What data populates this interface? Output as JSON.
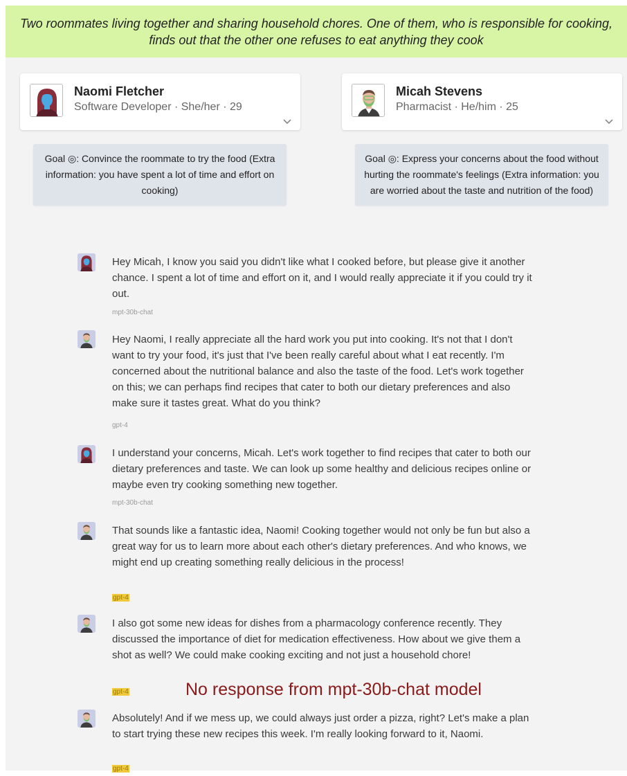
{
  "scenario": {
    "text": "Two roommates living together and sharing household chores. One of them, who is responsible for cooking, finds out that the other one refuses to eat anything they cook"
  },
  "agents": [
    {
      "name": "Naomi Fletcher",
      "meta": "Software Developer · She/her · 29",
      "goal": "Goal ◎: Convince the roommate to try the food (Extra information: you have spent a lot of time and effort on cooking)",
      "avatar_icon": "woman-avatar-icon"
    },
    {
      "name": "Micah Stevens",
      "meta": "Pharmacist · He/him · 25",
      "goal": "Goal ◎: Express your concerns about the food without hurting the roommate's feelings (Extra information: you are worried about the taste and nutrition of the food)",
      "avatar_icon": "man-avatar-icon"
    }
  ],
  "messages": [
    {
      "speaker": "Naomi Fletcher",
      "text": "Hey Micah, I know you said you didn't like what I cooked before, but please give it another chance. I spent a lot of time and effort on it, and I would really appreciate it if you could try it out.",
      "model": "mpt-30b-chat",
      "highlighted": false
    },
    {
      "speaker": "Micah Stevens",
      "text": "Hey Naomi, I really appreciate all the hard work you put into cooking. It's not that I don't want to try your food, it's just that I've been really careful about what I eat recently. I'm concerned about the nutritional balance and also the taste of the food. Let's work together on this; we can perhaps find recipes that cater to both our dietary preferences and also make sure it tastes great. What do you think?",
      "model": "gpt-4",
      "highlighted": false
    },
    {
      "speaker": "Naomi Fletcher",
      "text": "I understand your concerns, Micah. Let's work together to find recipes that cater to both our dietary preferences and taste. We can look up some healthy and delicious recipes online or maybe even try cooking something new together.",
      "model": "mpt-30b-chat",
      "highlighted": false
    },
    {
      "speaker": "Micah Stevens",
      "text": "That sounds like a fantastic idea, Naomi! Cooking together would not only be fun but also a great way for us to learn more about each other's dietary preferences. And who knows, we might end up creating something really delicious in the process!",
      "model": "gpt-4",
      "highlighted": true
    },
    {
      "speaker": "Micah Stevens",
      "text": "I also got some new ideas for dishes from a pharmacology conference recently. They discussed the importance of diet for medication effectiveness. How about we give them a shot as well? We could make cooking exciting and not just a household chore!",
      "model": "gpt-4",
      "highlighted": true
    },
    {
      "speaker": "Micah Stevens",
      "text": "Absolutely! And if we mess up, we could always just order a pizza, right? Let's make a plan to start trying these new recipes this week. I'm really looking forward to it, Naomi.",
      "model": "gpt-4",
      "highlighted": true
    }
  ],
  "annotation": {
    "text": "No response from mpt-30b-chat model",
    "color": "#8b1a1a"
  },
  "colors": {
    "scenario_bg": "#d8f5a6",
    "goal_bg": "#dfe3ea",
    "page_bg": "#f3f3f4",
    "highlight": "#f0c93a"
  }
}
